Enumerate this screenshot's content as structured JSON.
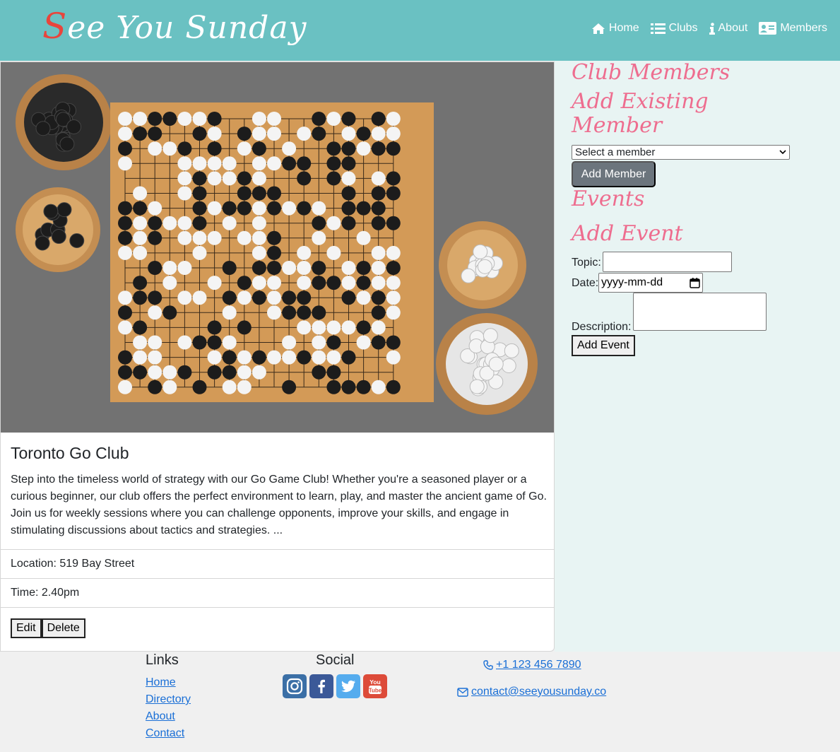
{
  "header": {
    "logo_initial": "S",
    "logo_rest": "ee You Sunday",
    "nav": [
      {
        "label": "Home",
        "icon": "home-icon"
      },
      {
        "label": "Clubs",
        "icon": "list-icon"
      },
      {
        "label": "About",
        "icon": "info-icon"
      },
      {
        "label": "Members",
        "icon": "id-card-icon"
      }
    ]
  },
  "club": {
    "image_alt": "Go board with black and white stones",
    "title": "Toronto Go Club",
    "description": "Step into the timeless world of strategy with our Go Game Club! Whether you're a seasoned player or a curious beginner, our club offers the perfect environment to learn, play, and master the ancient game of Go. Join us for weekly sessions where you can challenge opponents, improve your skills, and engage in stimulating discussions about tactics and strategies. ...",
    "location": "Location: 519 Bay Street",
    "time": "Time: 2.40pm",
    "edit_label": "Edit",
    "delete_label": "Delete"
  },
  "sidebar": {
    "club_members_heading": "Club Members",
    "add_existing_heading_line1": "Add Existing",
    "add_existing_heading_line2": "Member",
    "member_select_value": "Select a member",
    "add_member_label": "Add Member",
    "events_heading": "Events",
    "add_event_heading": "Add Event",
    "topic_label": "Topic:",
    "date_label": "Date:",
    "date_placeholder": "yyyy-mm-dd",
    "description_label": "Description:",
    "add_event_label": "Add Event"
  },
  "footer": {
    "links_heading": "Links",
    "links": [
      "Home",
      "Directory",
      "About",
      "Contact"
    ],
    "social_heading": "Social",
    "social": [
      {
        "name": "instagram-icon",
        "color": "#3b6fa6"
      },
      {
        "name": "facebook-icon",
        "color": "#3b5998"
      },
      {
        "name": "twitter-icon",
        "color": "#55acee"
      },
      {
        "name": "youtube-icon",
        "color": "#dd4b39"
      }
    ],
    "phone": "+1 123 456 7890",
    "email": "contact@seeyousunday.co"
  },
  "colors": {
    "header_bg": "#6ac1c2",
    "accent_pink": "#ee6d8f",
    "link_blue": "#1a6fd6",
    "sidebar_bg": "#e8f4f3"
  }
}
